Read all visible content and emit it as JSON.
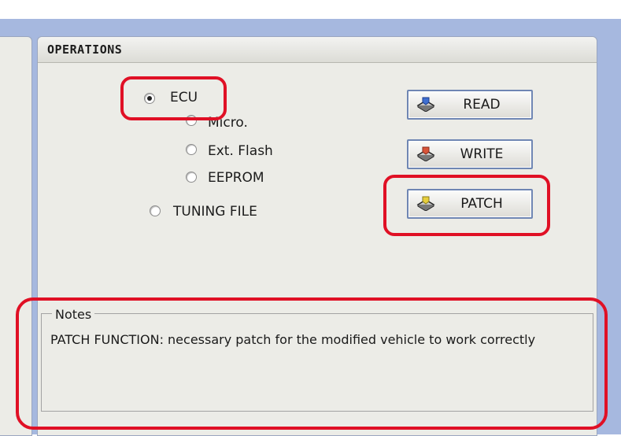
{
  "operations": {
    "title": "OPERATIONS",
    "options": {
      "ecu": "ECU",
      "micro": "Micro.",
      "ext_flash": "Ext. Flash",
      "eeprom": "EEPROM",
      "tuning_file": "TUNING FILE"
    },
    "selected_option": "ECU",
    "buttons": {
      "read": "READ",
      "write": "WRITE",
      "patch": "PATCH"
    }
  },
  "notes": {
    "label": "Notes",
    "text": "PATCH FUNCTION: necessary patch for the modified vehicle to work correctly"
  },
  "colors": {
    "highlight": "#e01025",
    "background": "#a6b8df",
    "panel": "#ecece7",
    "button_border": "#6f86b3"
  },
  "icons": {
    "read": "chip-read-icon",
    "write": "chip-write-icon",
    "patch": "chip-patch-icon"
  }
}
